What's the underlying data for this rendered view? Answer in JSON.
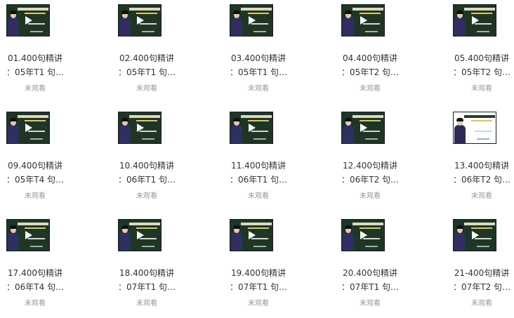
{
  "videos": [
    {
      "line1": "01.400句精讲",
      "line2": "：05年T1 句…",
      "status": "未观看",
      "thumb_style": "dark"
    },
    {
      "line1": "02.400句精讲",
      "line2": "：05年T1 句…",
      "status": "未观看",
      "thumb_style": "dark"
    },
    {
      "line1": "03.400句精讲",
      "line2": "：05年T1 句…",
      "status": "未观看",
      "thumb_style": "dark"
    },
    {
      "line1": "04.400句精讲",
      "line2": "：05年T2 句…",
      "status": "未观看",
      "thumb_style": "dark"
    },
    {
      "line1": "05.400句精讲",
      "line2": "：05年T2 句…",
      "status": "未观看",
      "thumb_style": "dark"
    },
    {
      "line1": "09.400句精讲",
      "line2": "：05年T4 句…",
      "status": "未观看",
      "thumb_style": "dark"
    },
    {
      "line1": "10.400句精讲",
      "line2": "：06年T1 句…",
      "status": "未观看",
      "thumb_style": "dark"
    },
    {
      "line1": "11.400句精讲",
      "line2": "：06年T1 句…",
      "status": "未观看",
      "thumb_style": "dark"
    },
    {
      "line1": "12.400句精讲",
      "line2": "：06年T2 句…",
      "status": "未观看",
      "thumb_style": "dark"
    },
    {
      "line1": "13.400句精讲",
      "line2": "：06年T2 句…",
      "status": "未观看",
      "thumb_style": "light"
    },
    {
      "line1": "17.400句精讲",
      "line2": "：06年T4 句…",
      "status": "未观看",
      "thumb_style": "dark"
    },
    {
      "line1": "18.400句精讲",
      "line2": "：07年T1 句…",
      "status": "未观看",
      "thumb_style": "dark"
    },
    {
      "line1": "19.400句精讲",
      "line2": "：07年T1 句…",
      "status": "未观看",
      "thumb_style": "dark"
    },
    {
      "line1": "20.400句精讲",
      "line2": "：07年T1 句…",
      "status": "未观看",
      "thumb_style": "dark"
    },
    {
      "line1": "21-400句精讲",
      "line2": "：07年T2 句…",
      "status": "未观看",
      "thumb_style": "dark"
    }
  ]
}
